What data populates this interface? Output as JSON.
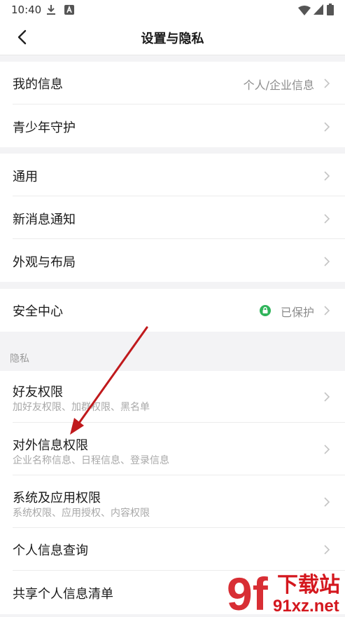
{
  "status": {
    "time": "10:40"
  },
  "header": {
    "title": "设置与隐私"
  },
  "groups": {
    "g1": [
      {
        "label": "我的信息",
        "value": "个人/企业信息"
      },
      {
        "label": "青少年守护"
      }
    ],
    "g2": [
      {
        "label": "通用"
      },
      {
        "label": "新消息通知"
      },
      {
        "label": "外观与布局"
      }
    ],
    "g3": [
      {
        "label": "安全中心",
        "value": "已保护"
      }
    ]
  },
  "privacy": {
    "section_title": "隐私",
    "items": [
      {
        "label": "好友权限",
        "sub": "加好友权限、加群权限、黑名单"
      },
      {
        "label": "对外信息权限",
        "sub": "企业名称信息、日程信息、登录信息"
      },
      {
        "label": "系统及应用权限",
        "sub": "系统权限、应用授权、内容权限"
      },
      {
        "label": "个人信息查询"
      },
      {
        "label": "共享个人信息清单"
      }
    ]
  },
  "watermark": {
    "logo": "9f",
    "line1": "下载站",
    "line2": "91xz.net"
  },
  "colors": {
    "accent_green": "#2fb45a",
    "annotation_red": "#c0191c",
    "watermark_red": "#d4171e"
  }
}
